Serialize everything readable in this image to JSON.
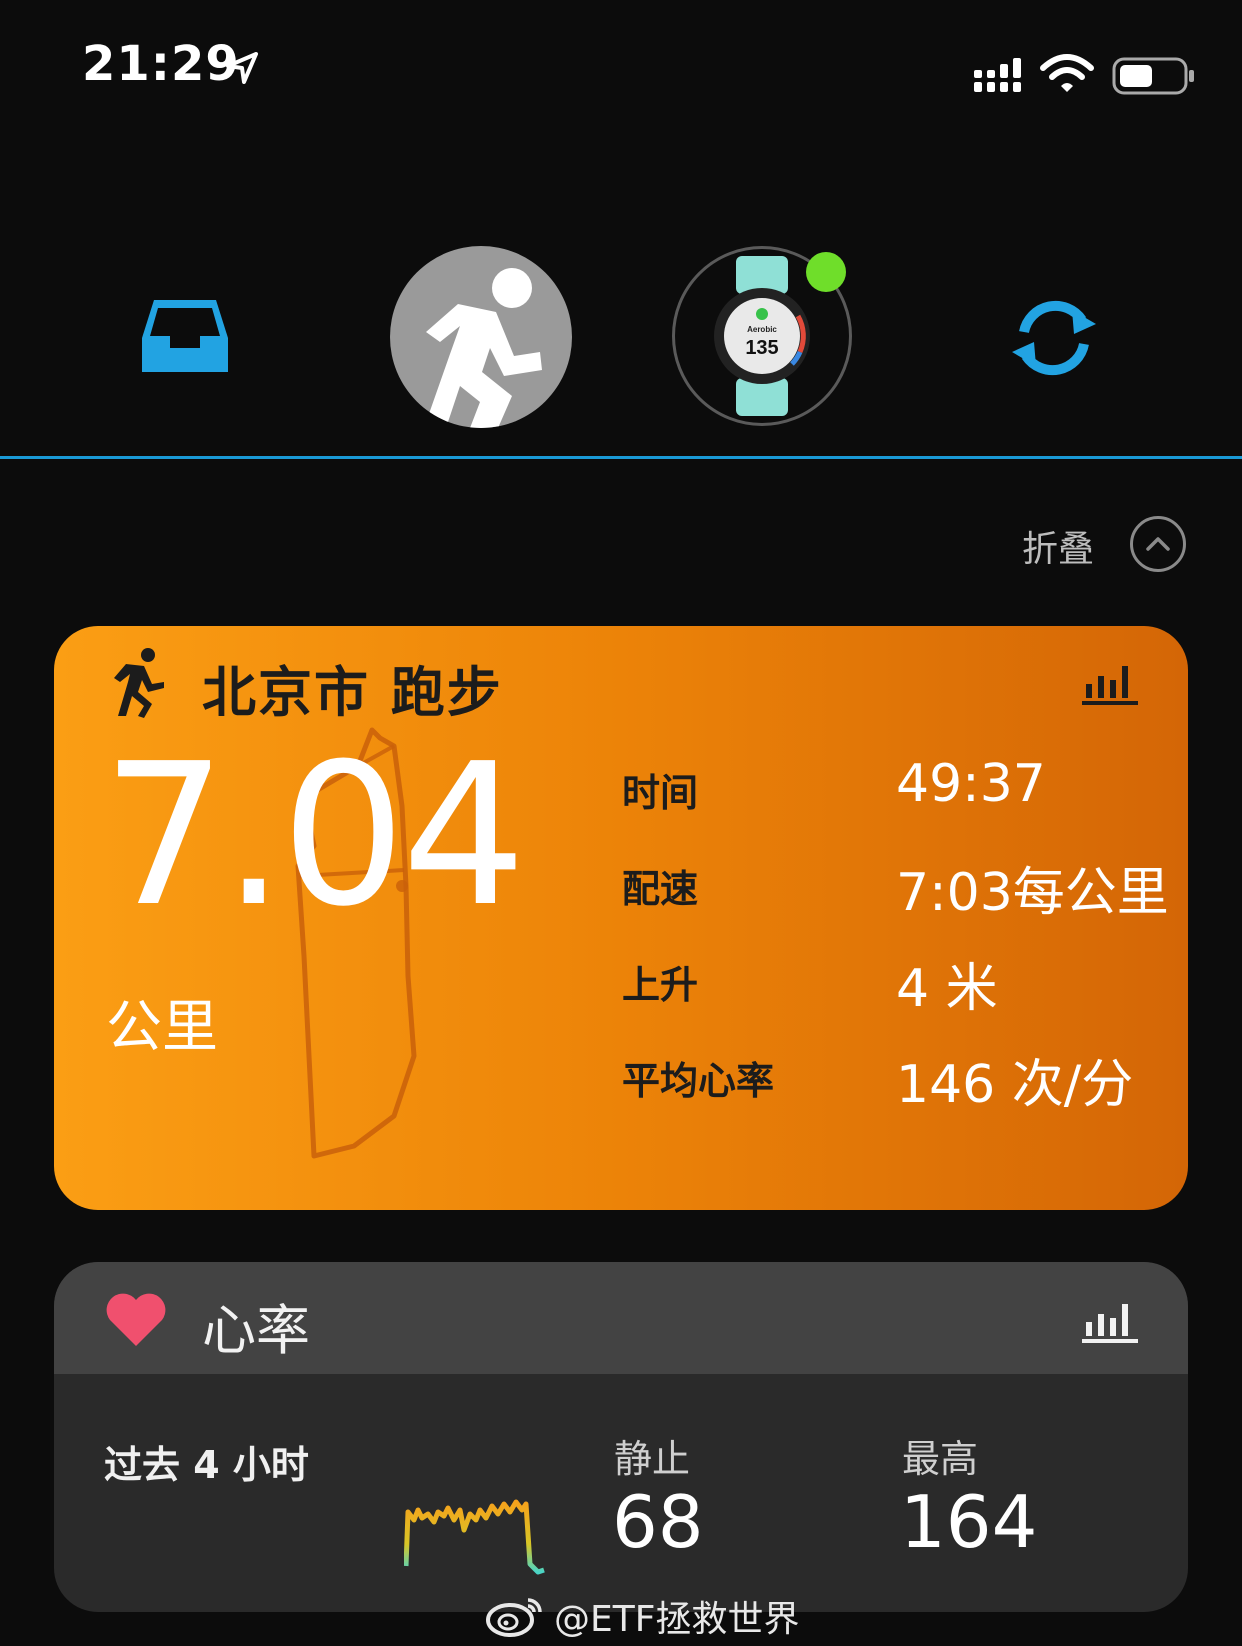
{
  "status_bar": {
    "time": "21:29"
  },
  "collapse": {
    "label": "折叠"
  },
  "activity": {
    "title": "北京市 跑步",
    "distance": "7.04",
    "distance_unit": "公里",
    "stats": [
      {
        "label": "时间",
        "value": "49:37"
      },
      {
        "label": "配速",
        "value": "7:03每公里"
      },
      {
        "label": "上升",
        "value": "4 米"
      },
      {
        "label": "平均心率",
        "value": "146 次/分"
      }
    ]
  },
  "heart_rate": {
    "title": "心率",
    "period": "过去 4 小时",
    "resting_label": "静止",
    "resting_value": "68",
    "max_label": "最高",
    "max_value": "164"
  },
  "watch_face": {
    "mode": "Aerobic",
    "value": "135"
  },
  "watermark": "@ETF拯救世界",
  "colors": {
    "accent_blue": "#1a9ad6",
    "activity_orange": "#ec8308",
    "device_connected": "#6fde2a",
    "heart": "#f0506e"
  }
}
